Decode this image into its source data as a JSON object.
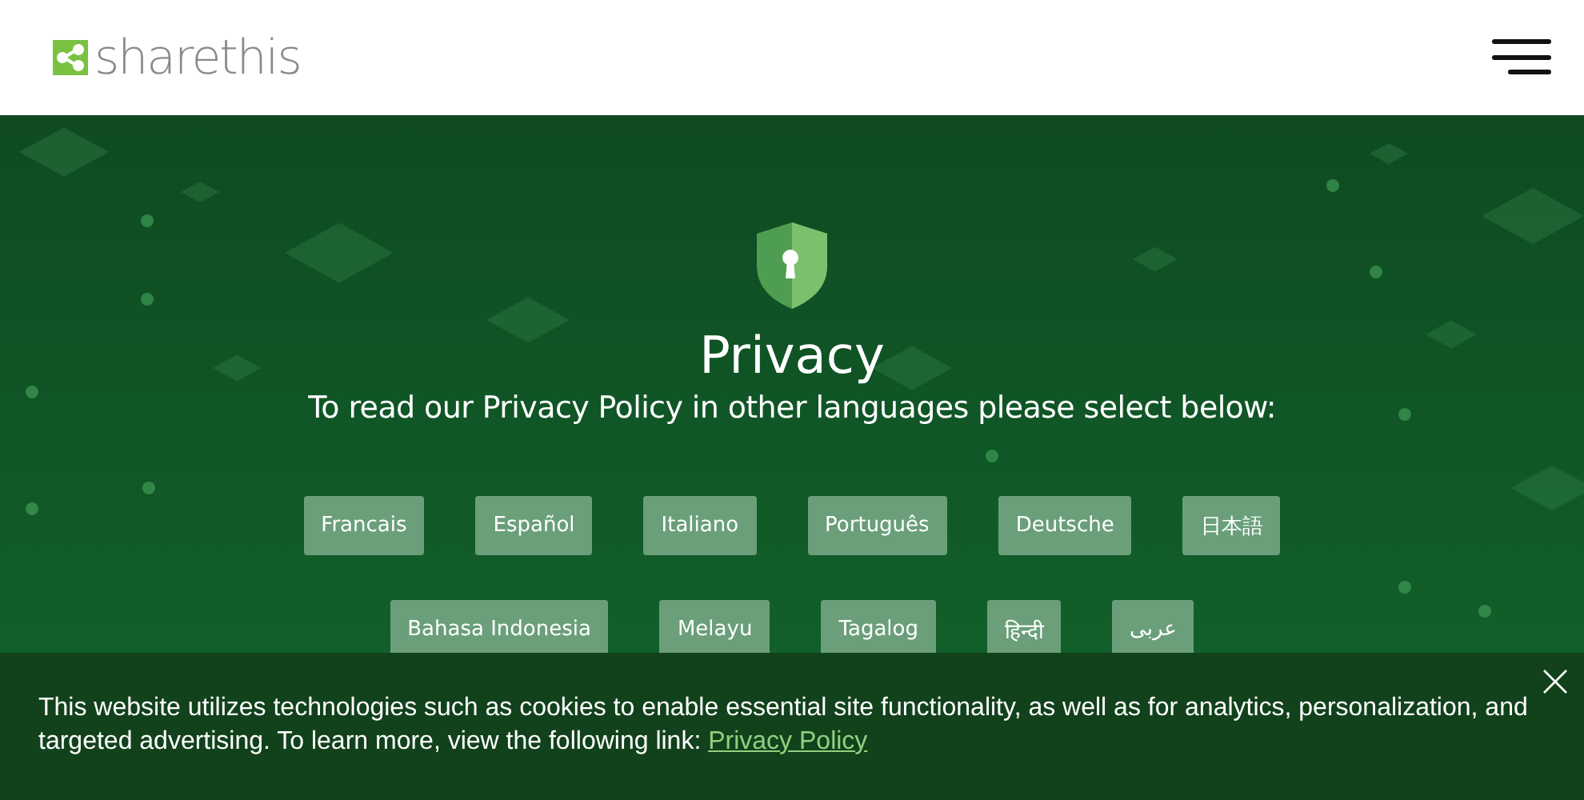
{
  "header": {
    "brand": "sharethis"
  },
  "hero": {
    "title": "Privacy",
    "subtitle": "To read our Privacy Policy in other languages please select below:"
  },
  "language_rows": [
    [
      "Francais",
      "Español",
      "Italiano",
      "Português",
      "Deutsche",
      "日本語"
    ],
    [
      "Bahasa Indonesia",
      "Melayu",
      "Tagalog",
      "हिन्दी",
      "عربى"
    ]
  ],
  "cookie_banner": {
    "text": "This website utilizes technologies such as cookies to enable essential site functionality, as well as for analytics, personalization, and targeted advertising. To learn more, view the following link:",
    "link": "Privacy Policy"
  }
}
